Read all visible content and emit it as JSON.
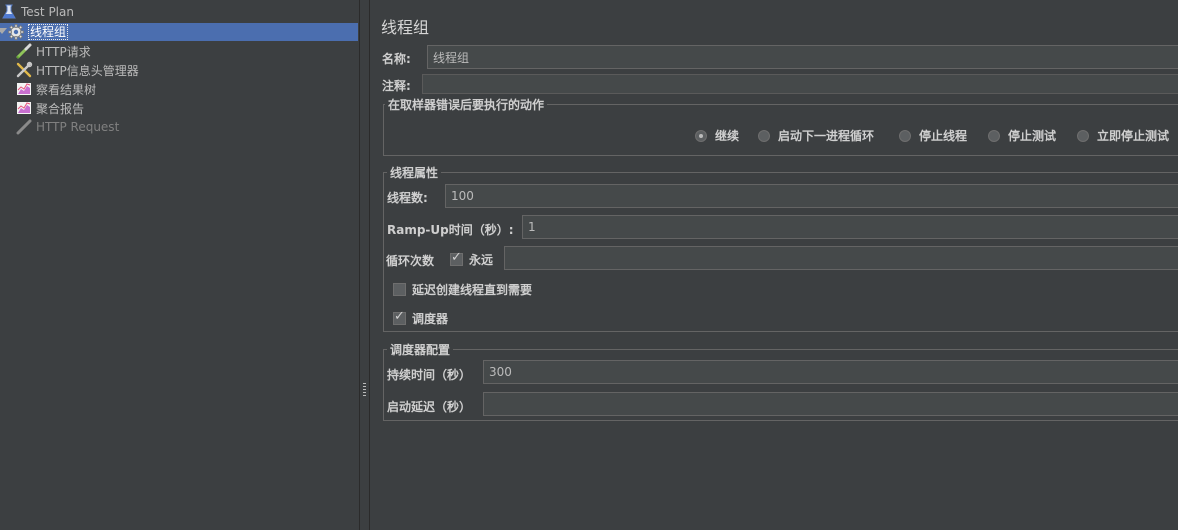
{
  "tree": {
    "items": [
      {
        "label": "Test Plan",
        "icon": "test-plan-icon"
      },
      {
        "label": "线程组",
        "icon": "gear-icon"
      },
      {
        "label": "HTTP请求",
        "icon": "pipette-icon"
      },
      {
        "label": "HTTP信息头管理器",
        "icon": "tools-icon"
      },
      {
        "label": "察看结果树",
        "icon": "chart-icon"
      },
      {
        "label": "聚合报告",
        "icon": "chart-icon"
      },
      {
        "label": "HTTP Request",
        "icon": "pipette-icon"
      }
    ]
  },
  "panel": {
    "title": "线程组",
    "name_label": "名称:",
    "name_value": "线程组",
    "comment_label": "注释:",
    "comment_value": "",
    "error_action": {
      "title": "在取样器错误后要执行的动作",
      "options": [
        "继续",
        "启动下一进程循环",
        "停止线程",
        "停止测试",
        "立即停止测试"
      ],
      "selected": "继续"
    },
    "thread_props": {
      "title": "线程属性",
      "threads_label": "线程数:",
      "threads_value": "100",
      "rampup_label": "Ramp-Up时间（秒）:",
      "rampup_value": "1",
      "loop_label": "循环次数",
      "forever_label": "永远",
      "forever_checked": true,
      "loop_value": "",
      "delay_label": "延迟创建线程直到需要",
      "delay_checked": false,
      "scheduler_label": "调度器",
      "scheduler_checked": true
    },
    "scheduler": {
      "title": "调度器配置",
      "duration_label": "持续时间（秒）",
      "duration_value": "300",
      "delay_label": "启动延迟（秒）",
      "delay_value": ""
    }
  },
  "colors": {
    "background": "#3c3f41",
    "selection": "#4b6eaf",
    "field": "#45494a"
  }
}
